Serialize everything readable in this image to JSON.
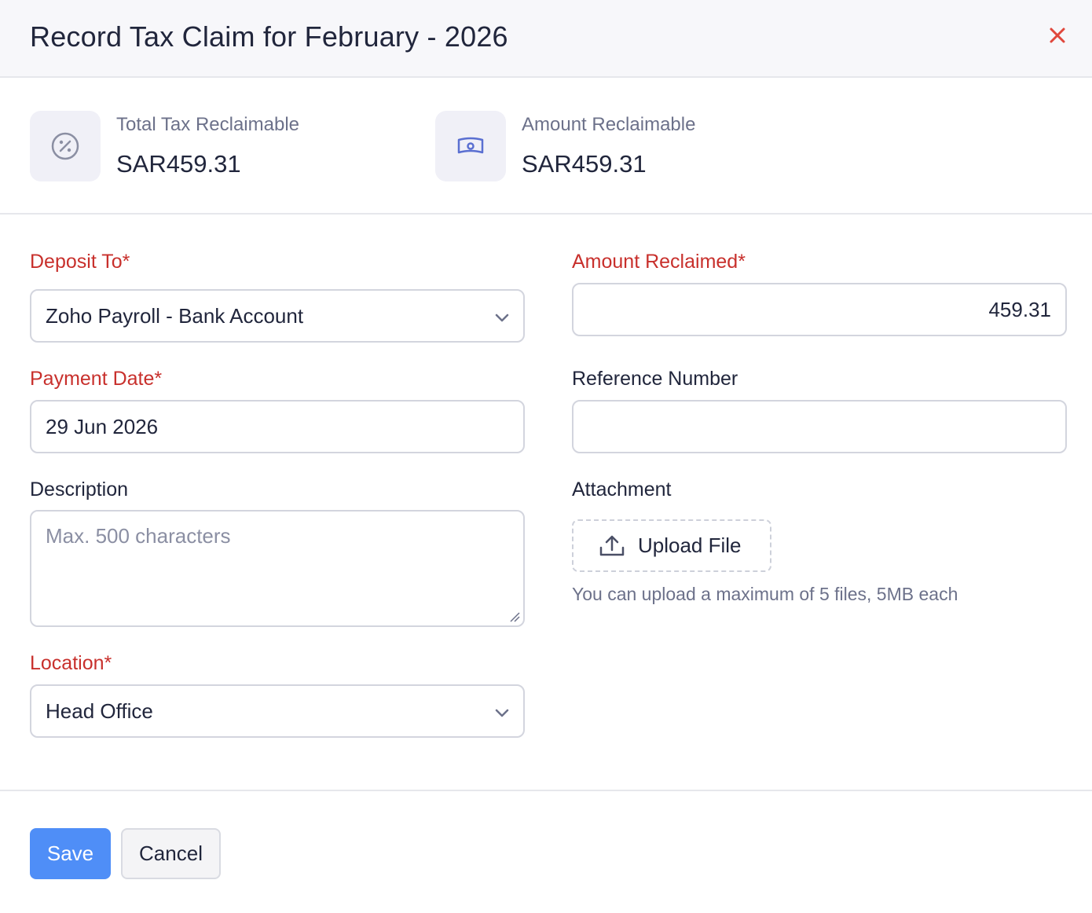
{
  "dialog": {
    "title": "Record Tax Claim for February - 2026",
    "close_icon": "close-icon"
  },
  "summary": {
    "total_tax": {
      "label": "Total Tax Reclaimable",
      "value": "SAR459.31",
      "icon": "percent-icon"
    },
    "amount": {
      "label": "Amount Reclaimable",
      "value": "SAR459.31",
      "icon": "money-icon"
    }
  },
  "form": {
    "deposit_to": {
      "label": "Deposit To*",
      "value": "Zoho Payroll - Bank Account",
      "icon": "chevron-down-icon"
    },
    "amount_reclaimed": {
      "label": "Amount Reclaimed*",
      "value": "459.31"
    },
    "payment_date": {
      "label": "Payment Date*",
      "value": "29 Jun 2026"
    },
    "reference_number": {
      "label": "Reference Number",
      "value": ""
    },
    "description": {
      "label": "Description",
      "placeholder": "Max. 500 characters"
    },
    "attachment": {
      "label": "Attachment",
      "upload_label": "Upload File",
      "hint": "You can upload a maximum of 5 files, 5MB each",
      "icon": "upload-icon"
    },
    "location": {
      "label": "Location*",
      "value": "Head Office",
      "icon": "chevron-down-icon"
    }
  },
  "footer": {
    "save_label": "Save",
    "cancel_label": "Cancel"
  },
  "colors": {
    "accent": "#4f8ef7",
    "required": "#c8302c",
    "close": "#e0473c"
  }
}
